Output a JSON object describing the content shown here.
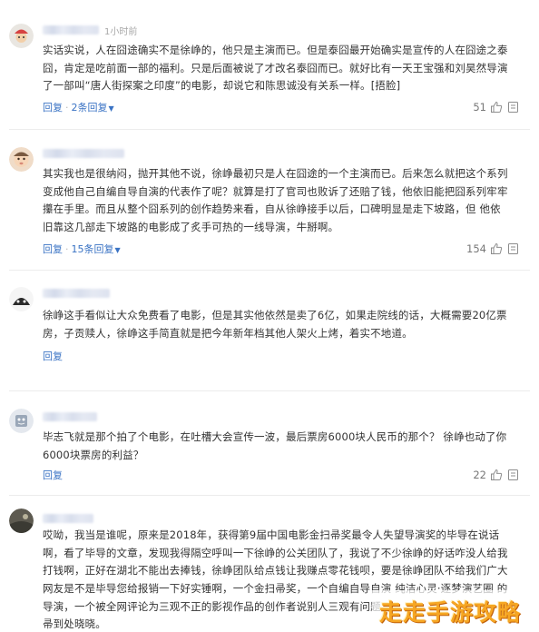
{
  "comments": [
    {
      "time": "1小时前",
      "lines": [
        "实话实说，人在囧途确实不是徐峥的，他只是主演而已。但是泰囧最开始确实是宣传的人在囧途之泰",
        "囧，肯定是吃前面一部的福利。只是后面被说了才改名泰囧而已。就好比有一天王宝强和刘昊然导演",
        "了一部叫“唐人街探案之印度”的电影，却说它和陈思诚没有关系一样。[捂脸]"
      ],
      "reply": "回复",
      "replies": "2条回复",
      "likes": "51",
      "avatar": "avatar-with-red-hat"
    },
    {
      "time": "",
      "lines": [
        "其实我也是很纳闷，抛开其他不说，徐峥最初只是人在囧途的一个主演而已。后来怎么就把这个系列",
        "变成他自己自编自导自演的代表作了呢？就算是打了官司也败诉了还赔了钱，他依旧能把囧系列牢牢",
        "攥在手里。而且从整个囧系列的创作趋势来看，自从徐峥接手以后，口碑明显是走下坡路，但 他依",
        "旧靠这几部走下坡路的电影成了炙手可热的一线导演，牛掰啊。"
      ],
      "reply": "回复",
      "replies": "15条回复",
      "likes": "154",
      "avatar": "avatar-baby"
    },
    {
      "time": "",
      "lines": [
        "徐峥这手看似让大众免费看了电影，但是其实他依然是卖了6亿，如果走院线的话，大概需要20亿票",
        "房，子贡赎人，徐峥这手简直就是把今年新年档其他人架火上烤，着实不地道。"
      ],
      "reply": "回复",
      "replies": "",
      "likes": "",
      "avatar": "avatar-cartoon-dark"
    },
    {
      "time": "",
      "lines": [
        "毕志飞就是那个拍了个电影，在吐槽大会宣传一波，最后票房6000块人民币的那个？ 徐峥也动了你",
        "6000块票房的利益？"
      ],
      "reply": "回复",
      "replies": "",
      "likes": "22",
      "avatar": "avatar-illustration"
    },
    {
      "time": "",
      "lines": [
        "哎呦，我当是谁呢，原来是2018年，获得第9届中国电影金扫帚奖最令人失望导演奖的毕导在说话",
        "啊，看了毕导的文章，发现我得隔空呼叫一下徐峥的公关团队了，我说了不少徐峥的好话咋没人给我",
        "打钱啊，正好在湖北不能出去捧钱，徐峥团队给点钱让我赚点零花钱呗，要是徐峥团队不给我们广大",
        "网友是不是毕导您给报销一下好实锤啊，一个金扫帚奖，一个自编自导自演 纯洁心灵·逐梦演艺圈 的",
        "导演，一个被全网评论为三观不正的影视作品的创作者说别人三观有问题",
        "帚到处晓晓。"
      ],
      "reply": "",
      "replies": "",
      "likes": "",
      "avatar": "avatar-dark-scene"
    }
  ],
  "watermark": "走走手游攻略",
  "colors": {
    "link": "#3a73c4",
    "text": "#333333",
    "muted": "#a8a8a8",
    "watermark": "#f6a623"
  }
}
